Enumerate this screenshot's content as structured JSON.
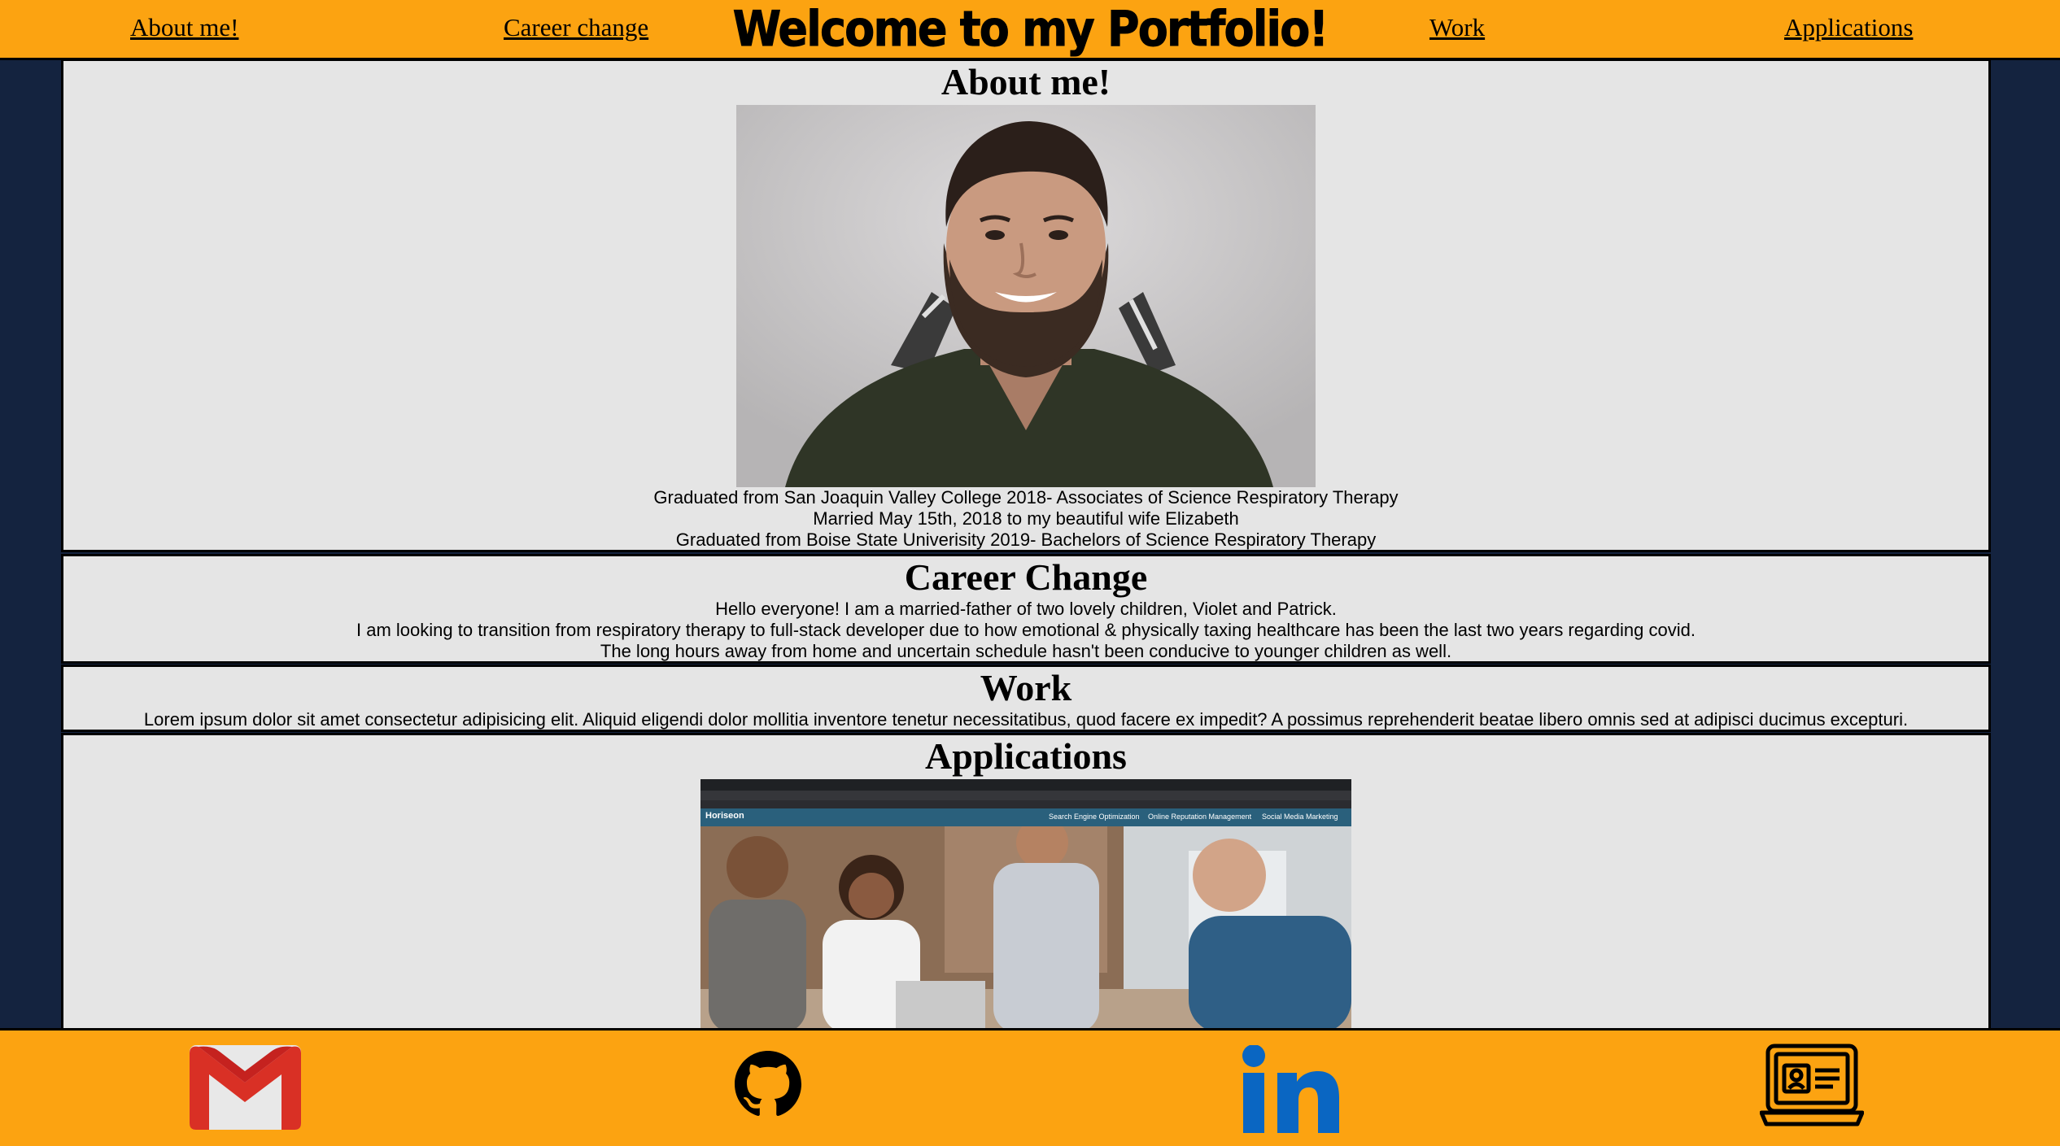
{
  "nav": {
    "about_label": "About me!",
    "career_label": "Career change",
    "title": "Welcome to my Portfolio!",
    "work_label": "Work",
    "applications_label": "Applications"
  },
  "about": {
    "heading": "About me!",
    "photo_icon": "portrait-photo",
    "lines": [
      "Graduated from San Joaquin Valley College 2018- Associates of Science Respiratory Therapy",
      "Married May 15th, 2018 to my beautiful wife Elizabeth",
      "Graduated from Boise State Univerisity 2019- Bachelors of Science Respiratory Therapy"
    ]
  },
  "career": {
    "heading": "Career Change",
    "lines": [
      "Hello everyone! I am a married-father of two lovely children, Violet and Patrick.",
      "I am looking to transition from respiratory therapy to full-stack developer due to how emotional & physically taxing healthcare has been the last two years regarding covid.",
      "The long hours away from home and uncertain schedule hasn't been conducive to younger children as well."
    ]
  },
  "work": {
    "heading": "Work",
    "text": "Lorem ipsum dolor sit amet consectetur adipisicing elit. Aliquid eligendi dolor mollitia inventore tenetur necessitatibus, quod facere ex impedit? A possimus reprehenderit beatae libero omnis sed at adipisci ducimus excepturi."
  },
  "applications": {
    "heading": "Applications",
    "screenshot": {
      "brand": "Horiseon",
      "nav_items": [
        "Search Engine Optimization",
        "Online Reputation Management",
        "Social Media Marketing"
      ]
    }
  },
  "footer": {
    "icons": [
      "gmail-icon",
      "github-icon",
      "linkedin-icon",
      "resume-icon"
    ]
  },
  "colors": {
    "accent": "#fca311",
    "page_background": "#14233f",
    "panel_background": "#e5e5e5",
    "gmail_red": "#d93025",
    "linkedin_blue": "#0a66c2"
  }
}
